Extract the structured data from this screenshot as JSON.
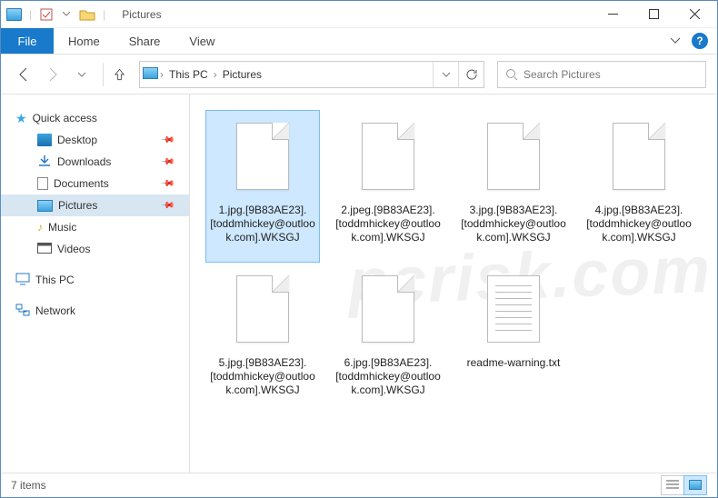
{
  "window": {
    "title": "Pictures",
    "min": "Minimize",
    "max": "Maximize",
    "close": "Close"
  },
  "ribbon": {
    "file": "File",
    "tabs": [
      "Home",
      "Share",
      "View"
    ]
  },
  "breadcrumb": {
    "items": [
      "This PC",
      "Pictures"
    ]
  },
  "search": {
    "placeholder": "Search Pictures"
  },
  "sidebar": {
    "quick": "Quick access",
    "items": [
      {
        "icon": "desktop",
        "label": "Desktop",
        "pinned": true
      },
      {
        "icon": "downloads",
        "label": "Downloads",
        "pinned": true
      },
      {
        "icon": "documents",
        "label": "Documents",
        "pinned": true
      },
      {
        "icon": "pictures",
        "label": "Pictures",
        "pinned": true,
        "selected": true
      },
      {
        "icon": "music",
        "label": "Music",
        "pinned": false
      },
      {
        "icon": "videos",
        "label": "Videos",
        "pinned": false
      }
    ],
    "thispc": "This PC",
    "network": "Network"
  },
  "files": [
    {
      "name": "1.jpg.[9B83AE23].[toddmhickey@outlook.com].WKSGJ",
      "type": "file",
      "selected": true
    },
    {
      "name": "2.jpeg.[9B83AE23].[toddmhickey@outlook.com].WKSGJ",
      "type": "file"
    },
    {
      "name": "3.jpg.[9B83AE23].[toddmhickey@outlook.com].WKSGJ",
      "type": "file"
    },
    {
      "name": "4.jpg.[9B83AE23].[toddmhickey@outlook.com].WKSGJ",
      "type": "file"
    },
    {
      "name": "5.jpg.[9B83AE23].[toddmhickey@outlook.com].WKSGJ",
      "type": "file"
    },
    {
      "name": "6.jpg.[9B83AE23].[toddmhickey@outlook.com].WKSGJ",
      "type": "file"
    },
    {
      "name": "readme-warning.txt",
      "type": "txt"
    }
  ],
  "status": {
    "count": "7 items"
  },
  "watermark": "pcrisk.com"
}
